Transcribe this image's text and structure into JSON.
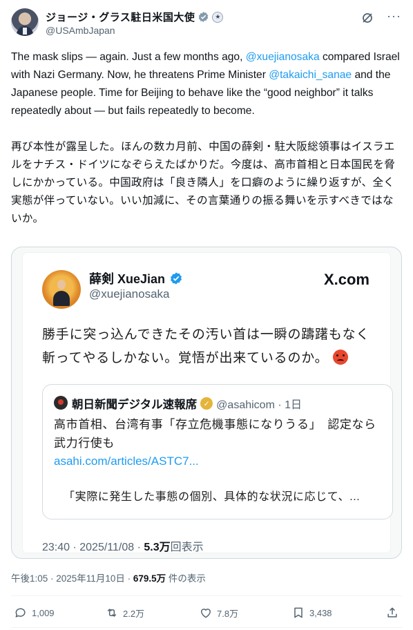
{
  "author": {
    "display_name": "ジョージ・グラス駐日米国大使",
    "handle": "@USAmbJapan"
  },
  "tweet": {
    "en_segments": [
      {
        "text": "The mask slips — again. Just a few months ago, ",
        "mention": false
      },
      {
        "text": "@xuejianosaka",
        "mention": true
      },
      {
        "text": " compared Israel with Nazi Germany. Now, he threatens Prime Minister ",
        "mention": false
      },
      {
        "text": "@takaichi_sanae",
        "mention": true
      },
      {
        "text": " and the Japanese people. Time for Beijing to behave like the “good neighbor” it talks repeatedly about — but fails repeatedly to become.",
        "mention": false
      }
    ],
    "jp_text": "再び本性が露呈した。ほんの数カ月前、中国の薛剣・駐大阪総領事はイスラエルをナチス・ドイツになぞらえたばかりだ。今度は、高市首相と日本国民を脅しにかかっている。中国政府は「良き隣人」を口癖のように繰り返すが、全く実態が伴っていない。いい加減に、その言葉通りの振る舞いを示すべきではないか。"
  },
  "quoted_screenshot": {
    "name": "薛剣 XueJian",
    "handle": "@xuejianosaka",
    "brand": "X.com",
    "text": "勝手に突っ込んできたその汚い首は一瞬の躊躇もなく斬ってやるしかない。覚悟が出来ているのか。",
    "inner": {
      "name": "朝日新聞デジタル速報席",
      "meta": "@asahicom · 1日",
      "text": "高市首相、台湾有事「存立危機事態になりうる」　認定なら武力行使も",
      "link": "asahi.com/articles/ASTC7...",
      "quote": "「実際に発生した事態の個別、具体的な状況に応じて、..."
    },
    "footer_time": "23:40 · 2025/11/08 · ",
    "footer_views": "5.3万",
    "footer_views_label": "回表示"
  },
  "meta": {
    "time": "午後1:05 · 2025年11月10日 · ",
    "views": "679.5万",
    "views_label": " 件の表示"
  },
  "actions": {
    "replies": "1,009",
    "reposts": "2.2万",
    "likes": "7.8万",
    "bookmarks": "3,438"
  },
  "colors": {
    "accent": "#1d9bf0",
    "muted": "#536471",
    "text": "#0f1419"
  }
}
